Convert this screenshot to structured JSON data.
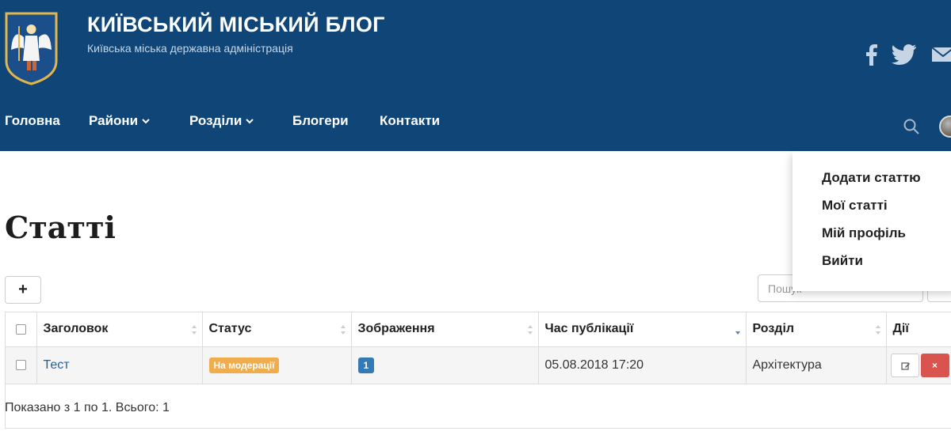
{
  "header": {
    "title": "КИЇВСЬКИЙ МІСЬКИЙ БЛОГ",
    "subtitle": "Київська міська державна адміністрація",
    "bg_color": "#0f4677",
    "social": [
      "facebook-icon",
      "twitter-icon",
      "mail-icon"
    ]
  },
  "nav": {
    "items": [
      {
        "label": "Головна",
        "dropdown": false
      },
      {
        "label": "Райони",
        "dropdown": true
      },
      {
        "label": "Розділи",
        "dropdown": true
      },
      {
        "label": "Блогери",
        "dropdown": false
      },
      {
        "label": "Контакти",
        "dropdown": false
      }
    ]
  },
  "user_menu": {
    "items": [
      "Додати статтю",
      "Мої статті",
      "Мій профіль",
      "Вийти"
    ]
  },
  "page": {
    "title": "Статті",
    "add_label": "+",
    "search_placeholder": "Пошук"
  },
  "table": {
    "columns": [
      "Заголовок",
      "Статус",
      "Зображення",
      "Час публікації",
      "Розділ",
      "Дії"
    ],
    "rows": [
      {
        "title": "Тест",
        "status": "На модерації",
        "images": "1",
        "published": "05.08.2018 17:20",
        "section": "Архітектура",
        "delete_label": "×"
      }
    ],
    "footer": "Показано з 1 по 1. Всього: 1"
  },
  "colors": {
    "status_moderation": "#f0ad4e",
    "badge_images": "#337ab7",
    "delete": "#d9534f",
    "link": "#1f5fa6"
  }
}
